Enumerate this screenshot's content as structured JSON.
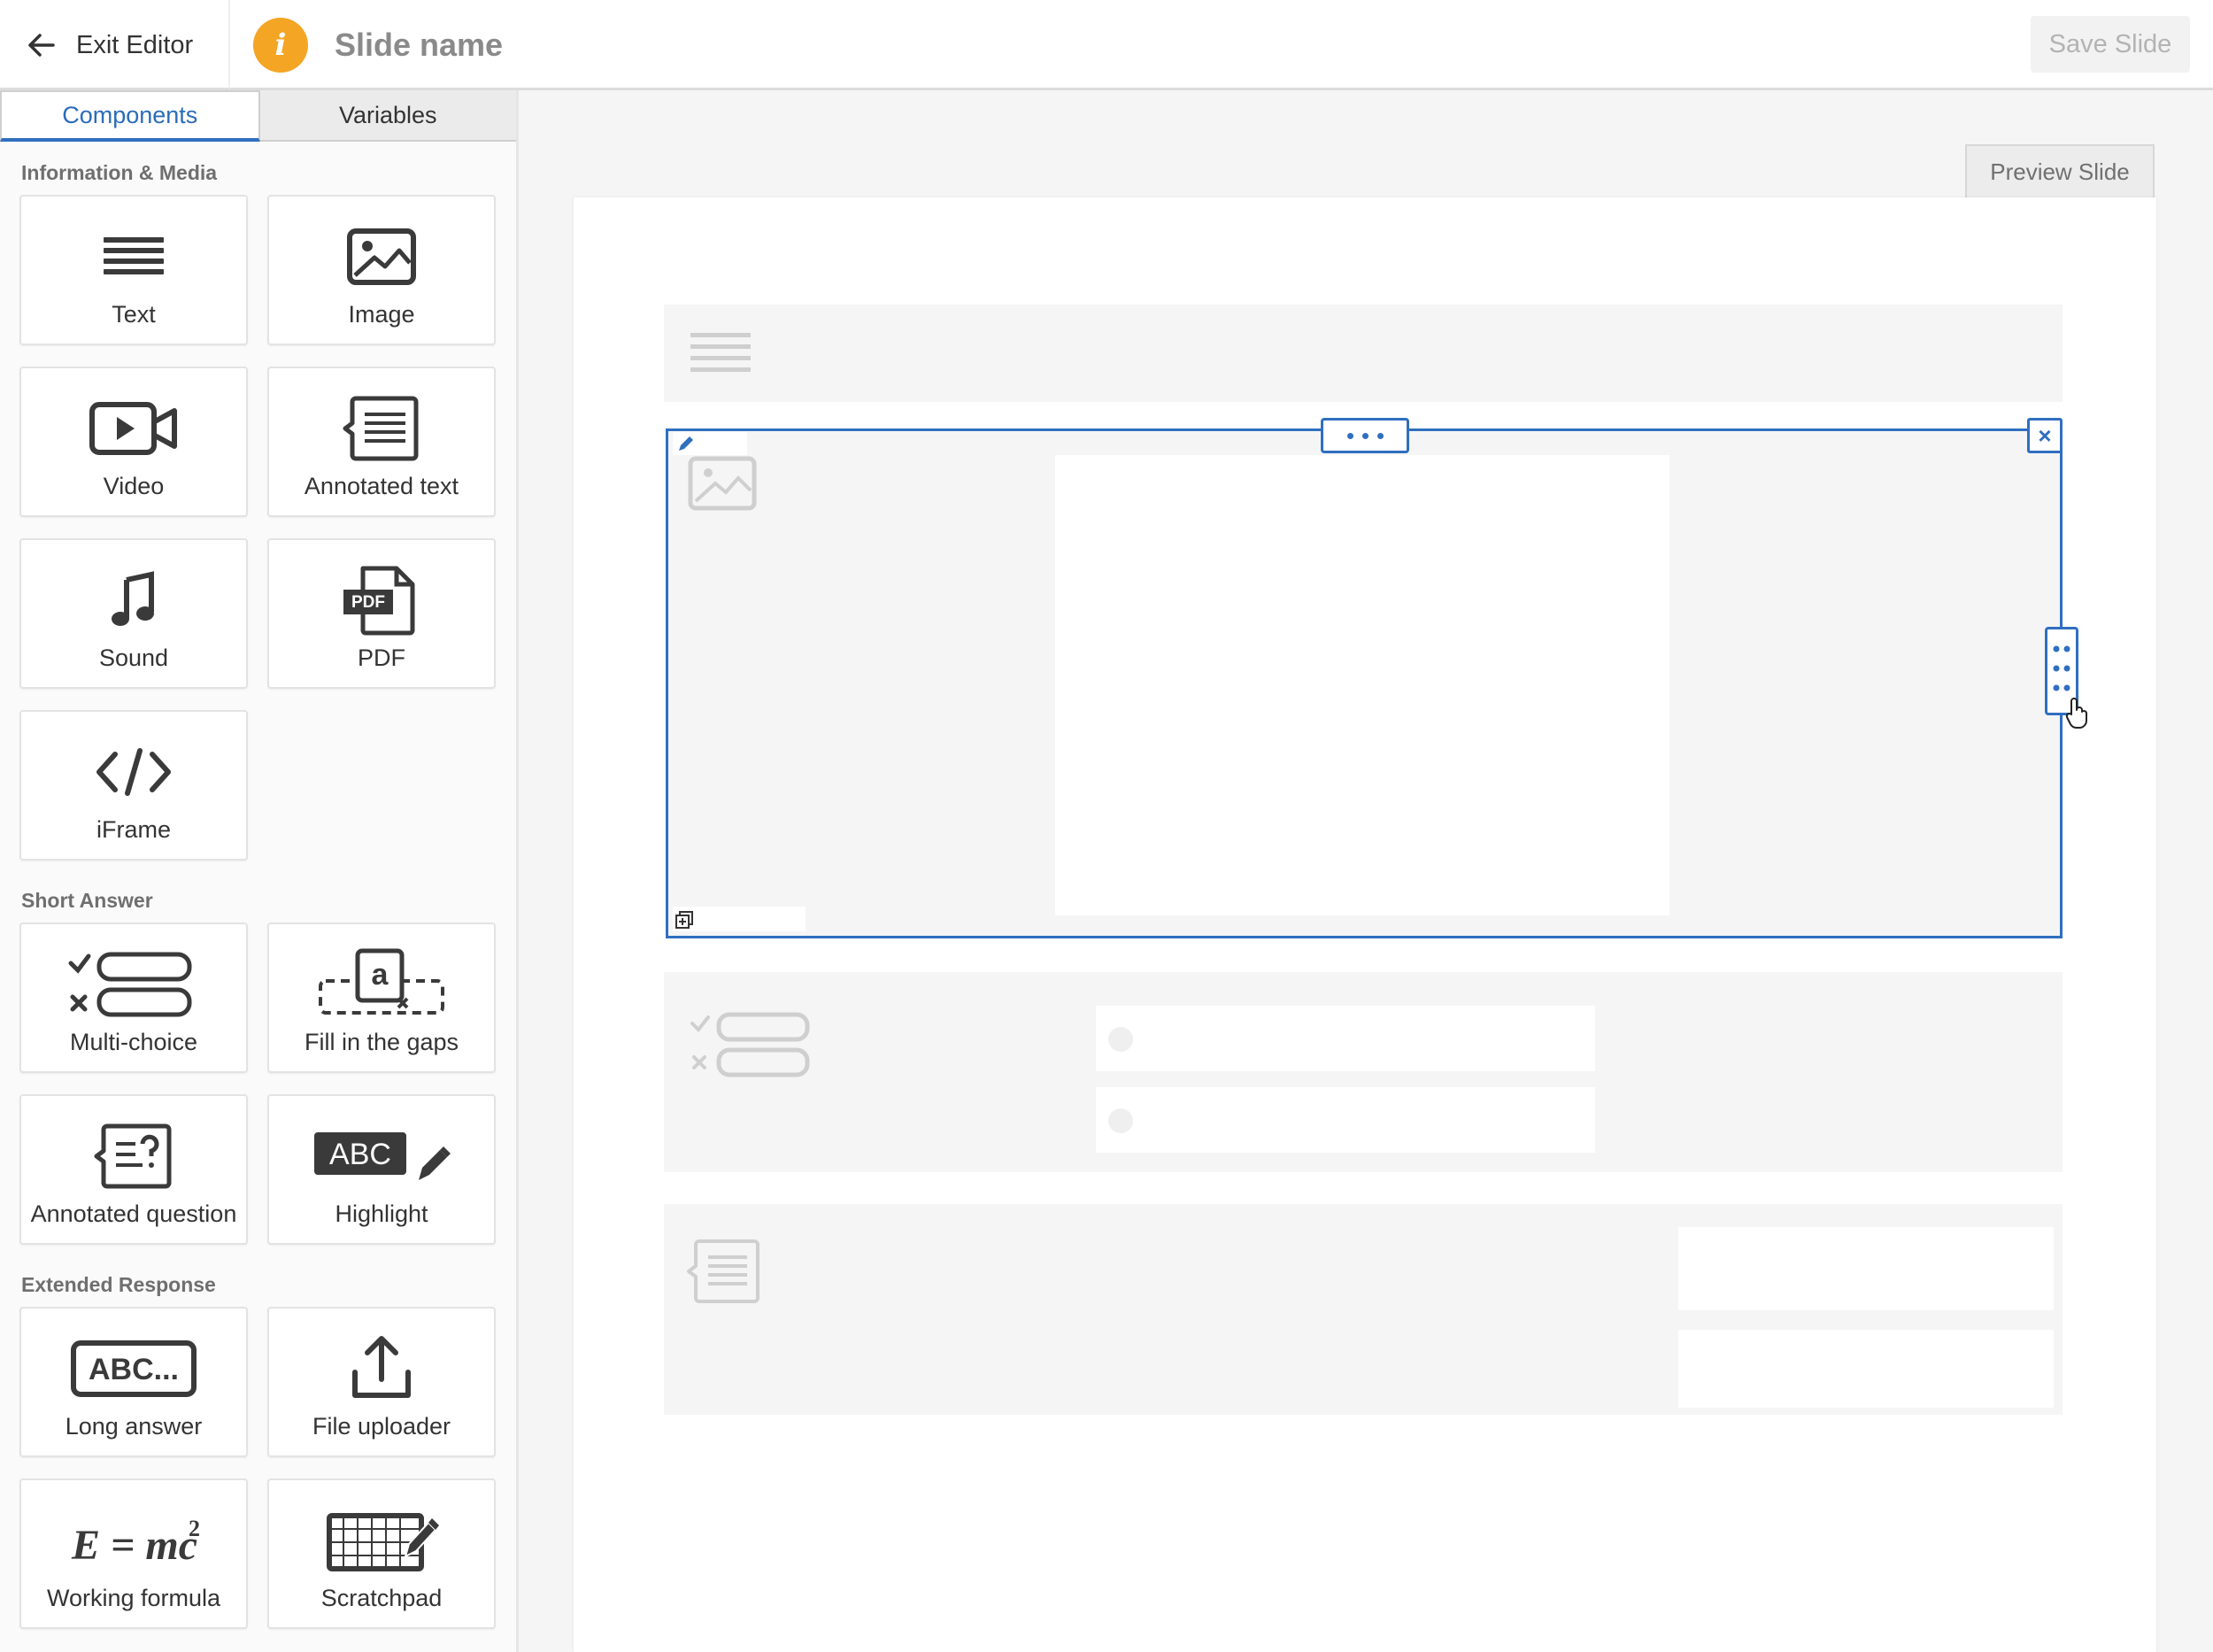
{
  "header": {
    "exit_label": "Exit Editor",
    "info_glyph": "i",
    "slide_name": "Slide name",
    "save_label": "Save Slide"
  },
  "sidebar": {
    "tabs": [
      {
        "label": "Components",
        "active": true
      },
      {
        "label": "Variables",
        "active": false
      }
    ],
    "sections": [
      {
        "title": "Information & Media",
        "items": [
          {
            "label": "Text",
            "icon": "text-lines-icon"
          },
          {
            "label": "Image",
            "icon": "image-icon"
          },
          {
            "label": "Video",
            "icon": "video-icon"
          },
          {
            "label": "Annotated text",
            "icon": "annotated-text-icon"
          },
          {
            "label": "Sound",
            "icon": "music-note-icon"
          },
          {
            "label": "PDF",
            "icon": "pdf-file-icon"
          },
          {
            "label": "iFrame",
            "icon": "code-icon"
          }
        ]
      },
      {
        "title": "Short Answer",
        "items": [
          {
            "label": "Multi-choice",
            "icon": "multi-choice-icon"
          },
          {
            "label": "Fill in the gaps",
            "icon": "fill-gaps-icon"
          },
          {
            "label": "Annotated question",
            "icon": "annotated-question-icon"
          },
          {
            "label": "Highlight",
            "icon": "highlight-icon"
          }
        ]
      },
      {
        "title": "Extended Response",
        "items": [
          {
            "label": "Long answer",
            "icon": "long-answer-icon"
          },
          {
            "label": "File uploader",
            "icon": "upload-icon"
          },
          {
            "label": "Working formula",
            "icon": "formula-icon"
          },
          {
            "label": "Scratchpad",
            "icon": "scratchpad-icon"
          }
        ]
      }
    ]
  },
  "icon_text": {
    "pdf": "PDF",
    "abc": "ABC",
    "abc_dots": "ABC...",
    "gap_letter": "a",
    "formula": "E = mc",
    "formula_sup": "2"
  },
  "canvas": {
    "preview_label": "Preview Slide",
    "close_glyph": "×"
  },
  "colors": {
    "accent": "#2f6fc0",
    "info_badge": "#f5a524",
    "canvas_bg": "#f5f5f5"
  }
}
